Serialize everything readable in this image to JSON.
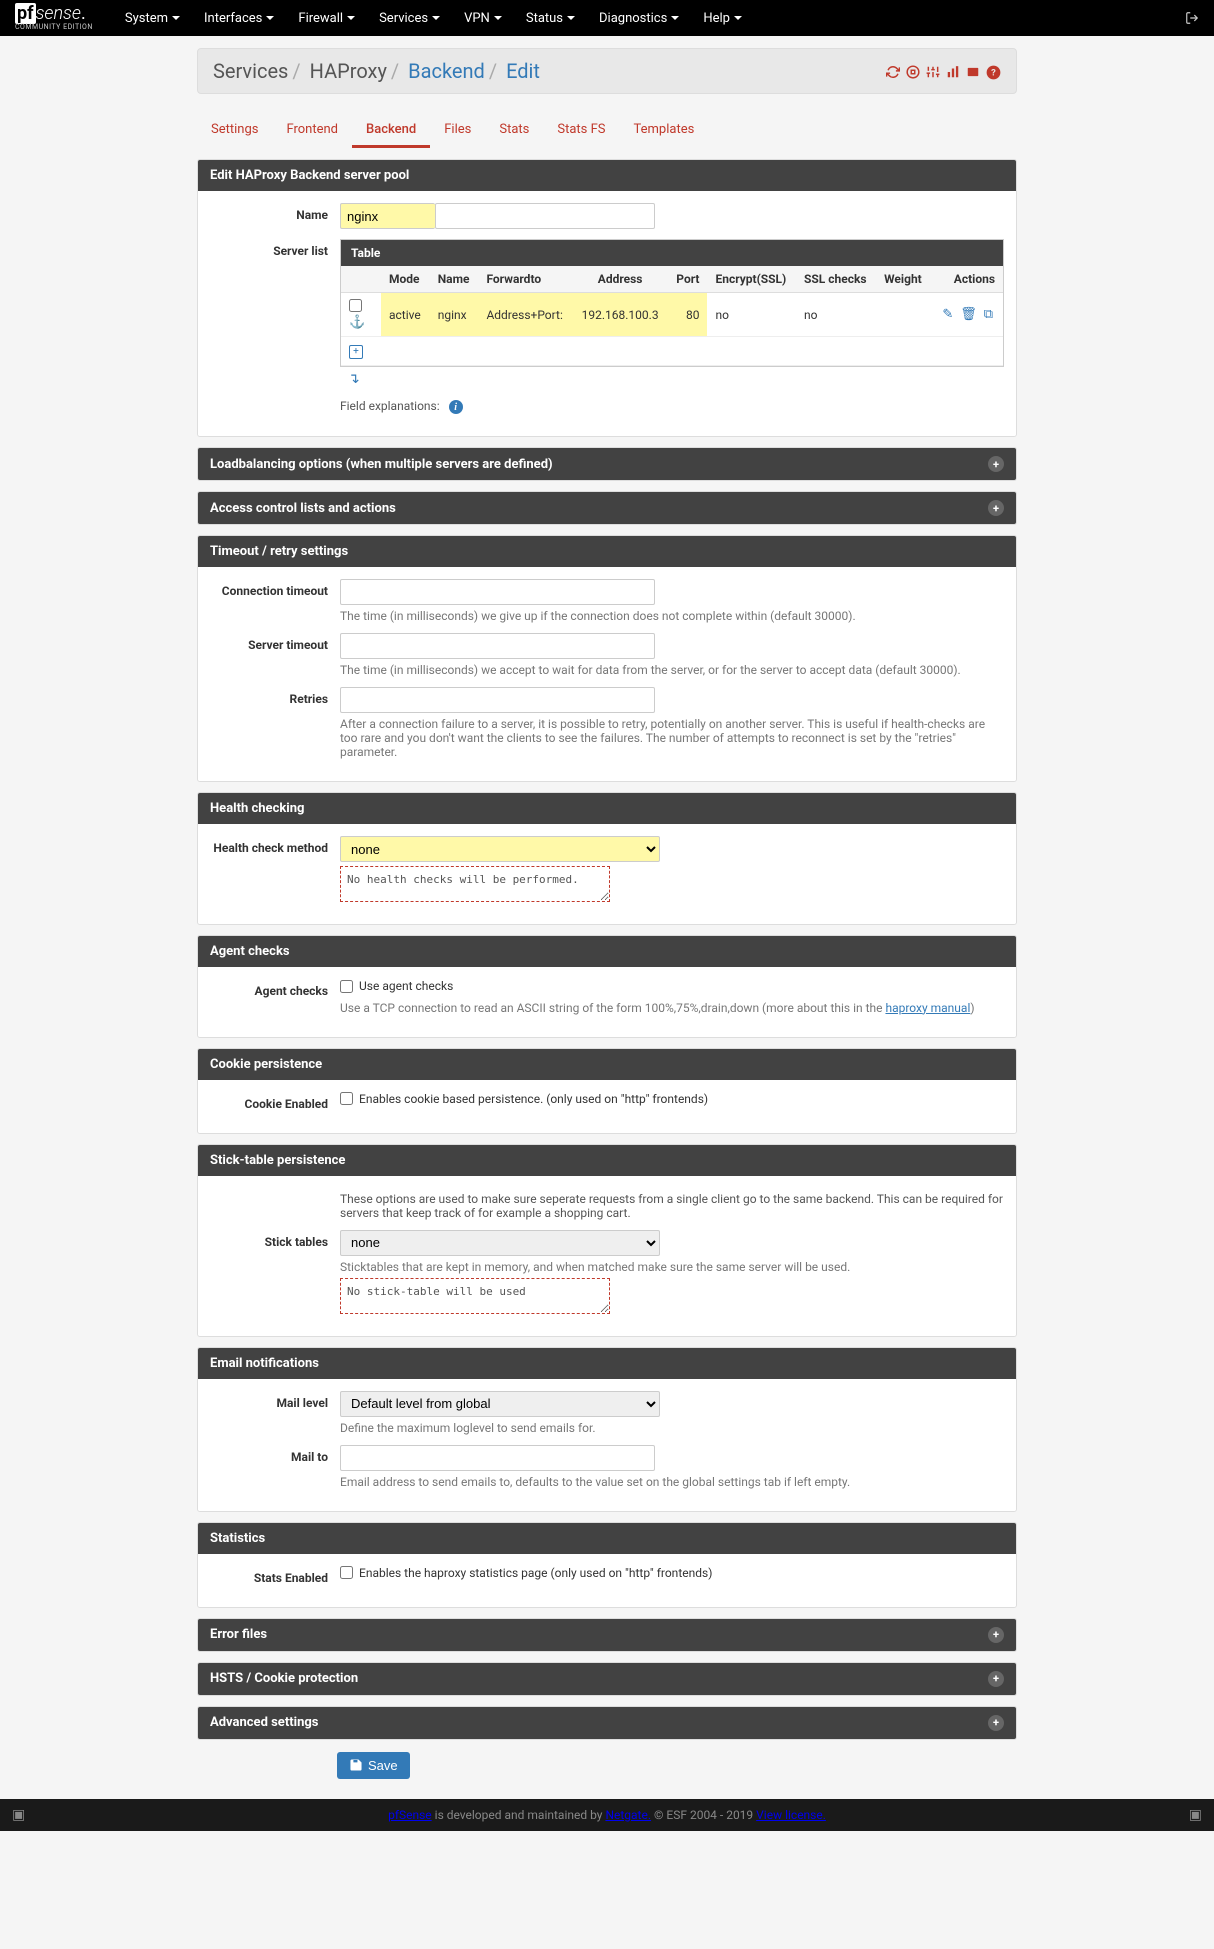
{
  "nav": [
    "System",
    "Interfaces",
    "Firewall",
    "Services",
    "VPN",
    "Status",
    "Diagnostics",
    "Help"
  ],
  "logo_sub": "COMMUNITY EDITION",
  "breadcrumb": {
    "a": "Services",
    "b": "HAProxy",
    "c": "Backend",
    "d": "Edit"
  },
  "tabs": [
    "Settings",
    "Frontend",
    "Backend",
    "Files",
    "Stats",
    "Stats FS",
    "Templates"
  ],
  "active_tab": "Backend",
  "panels": {
    "edit_pool": "Edit HAProxy Backend server pool",
    "lb_options": "Loadbalancing options (when multiple servers are defined)",
    "acl": "Access control lists and actions",
    "timeout": "Timeout / retry settings",
    "health": "Health checking",
    "agent": "Agent checks",
    "cookie": "Cookie persistence",
    "sticktable": "Stick-table persistence",
    "email": "Email notifications",
    "stats": "Statistics",
    "error": "Error files",
    "hsts": "HSTS / Cookie protection",
    "advanced": "Advanced settings"
  },
  "labels": {
    "name": "Name",
    "server_list": "Server list",
    "conn_timeout": "Connection timeout",
    "server_timeout": "Server timeout",
    "retries": "Retries",
    "health_method": "Health check method",
    "agent_checks": "Agent checks",
    "cookie_enabled": "Cookie Enabled",
    "stick_tables": "Stick tables",
    "mail_level": "Mail level",
    "mail_to": "Mail to",
    "stats_enabled": "Stats Enabled",
    "field_expl": "Field explanations:"
  },
  "values": {
    "name": "nginx",
    "health_method": "none",
    "health_desc": "No health checks will be performed.",
    "stick_tables": "none",
    "stick_desc": "No stick-table will be used",
    "mail_level": "Default level from global"
  },
  "server_table": {
    "title": "Table",
    "headers": [
      "Mode",
      "Name",
      "Forwardto",
      "Address",
      "Port",
      "Encrypt(SSL)",
      "SSL checks",
      "Weight",
      "Actions"
    ],
    "row": {
      "mode": "active",
      "name": "nginx",
      "forwardto": "Address+Port:",
      "address": "192.168.100.3",
      "port": "80",
      "encrypt": "no",
      "sslchecks": "no",
      "weight": ""
    }
  },
  "help": {
    "conn_timeout": "The time (in milliseconds) we give up if the connection does not complete within (default 30000).",
    "server_timeout": "The time (in milliseconds) we accept to wait for data from the server, or for the server to accept data (default 30000).",
    "retries": "After a connection failure to a server, it is possible to retry, potentially on another server. This is useful if health-checks are too rare and you don't want the clients to see the failures. The number of attempts to reconnect is set by the \"retries\" parameter.",
    "agent_checks_label": "Use agent checks",
    "agent_checks_help": "Use a TCP connection to read an ASCII string of the form 100%,75%,drain,down (more about this in the ",
    "agent_link": "haproxy manual",
    "cookie_enabled": "Enables cookie based persistence. (only used on \"http\" frontends)",
    "sticktable_intro": "These options are used to make sure seperate requests from a single client go to the same backend. This can be required for servers that keep track of for example a shopping cart.",
    "sticktable_help": "Sticktables that are kept in memory, and when matched make sure the same server will be used.",
    "mail_level": "Define the maximum loglevel to send emails for.",
    "mail_to": "Email address to send emails to, defaults to the value set on the global settings tab if left empty.",
    "stats_enabled": "Enables the haproxy statistics page (only used on \"http\" frontends)"
  },
  "save": "Save",
  "footer": {
    "a": "pfSense",
    "b": " is developed and maintained by ",
    "c": "Netgate.",
    "d": " © ESF 2004 - 2019 ",
    "e": "View license."
  }
}
